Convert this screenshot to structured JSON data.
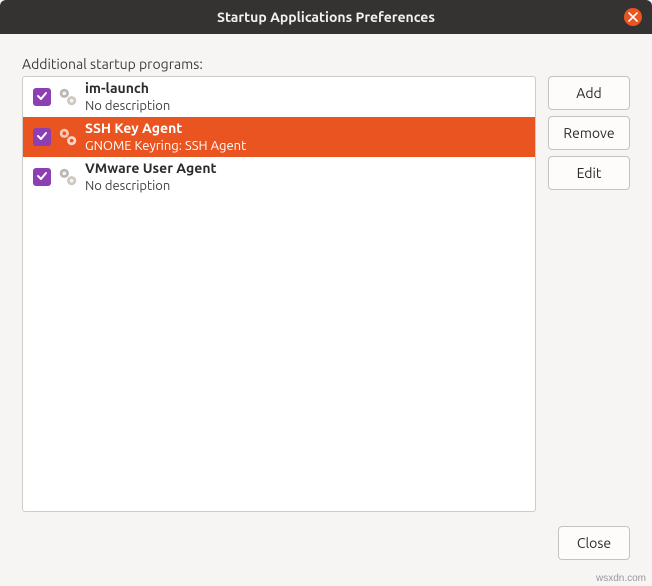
{
  "window": {
    "title": "Startup Applications Preferences"
  },
  "section_label": "Additional startup programs:",
  "items": [
    {
      "name": "im-launch",
      "description": "No description",
      "checked": true,
      "selected": false
    },
    {
      "name": "SSH Key Agent",
      "description": "GNOME Keyring: SSH Agent",
      "checked": true,
      "selected": true
    },
    {
      "name": "VMware User Agent",
      "description": "No description",
      "checked": true,
      "selected": false
    }
  ],
  "buttons": {
    "add": "Add",
    "remove": "Remove",
    "edit": "Edit",
    "close": "Close"
  },
  "watermark": "wsxdn.com"
}
